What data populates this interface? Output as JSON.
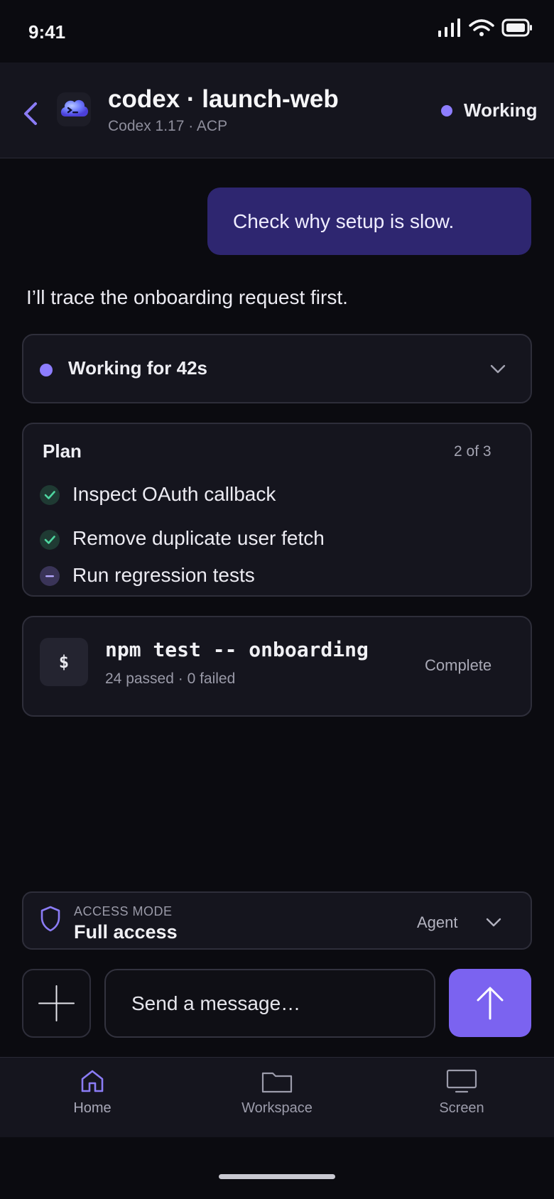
{
  "status_bar": {
    "time": "9:41"
  },
  "header": {
    "title": "codex · launch-web",
    "subtitle": "Codex 1.17 · ACP",
    "status": "Working"
  },
  "conversation": {
    "user_message": "Check why setup is slow.",
    "assistant_message": "I’ll trace the onboarding request first."
  },
  "working": {
    "label": "Working for 42s"
  },
  "plan": {
    "title": "Plan",
    "progress": "2 of 3",
    "items": [
      {
        "label": "Inspect OAuth callback",
        "state": "done"
      },
      {
        "label": "Remove duplicate user fetch",
        "state": "done"
      },
      {
        "label": "Run regression tests",
        "state": "in-progress"
      }
    ]
  },
  "command": {
    "icon_glyph": "$",
    "text": "npm test -- onboarding",
    "summary": "24 passed · 0 failed",
    "status": "Complete"
  },
  "access": {
    "label": "ACCESS MODE",
    "value": "Full access",
    "agent": "Agent"
  },
  "composer": {
    "placeholder": "Send a message…"
  },
  "tabs": [
    {
      "label": "Home",
      "icon": "home-icon",
      "active": true
    },
    {
      "label": "Workspace",
      "icon": "folder-icon",
      "active": false
    },
    {
      "label": "Screen",
      "icon": "monitor-icon",
      "active": false
    }
  ],
  "colors": {
    "accent": "#7b63f0",
    "accent_dot": "#8d7dff",
    "user_bubble": "#2e2670",
    "check": "#4ed6a0",
    "background": "#0b0b10",
    "card": "#15151e"
  }
}
